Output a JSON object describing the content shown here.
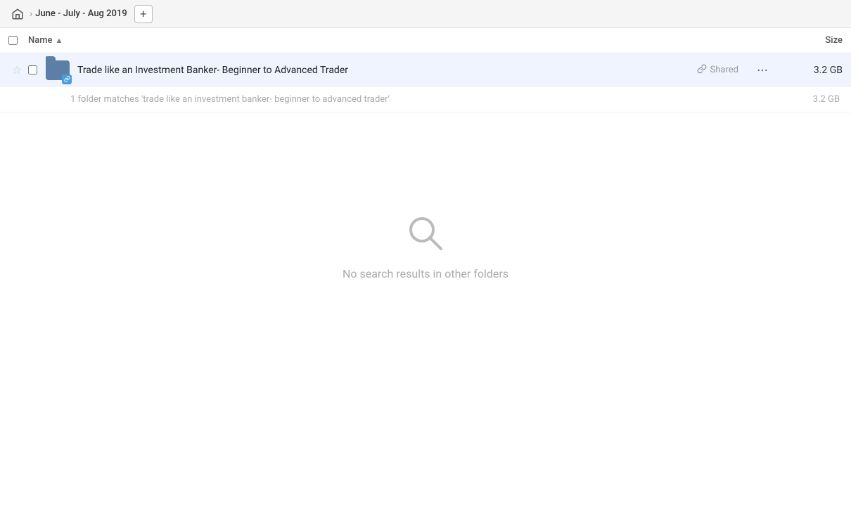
{
  "breadcrumb": {
    "home_icon": "⌂",
    "separator": "›",
    "title": "June - July - Aug 2019",
    "add_icon": "+"
  },
  "columns": {
    "name_label": "Name",
    "sort_arrow": "▲",
    "size_label": "Size"
  },
  "file_row": {
    "star_icon": "☆",
    "folder_icon_label": "folder",
    "link_badge": "🔗",
    "file_name": "Trade like an Investment Banker- Beginner to Advanced Trader",
    "shared_label": "Shared",
    "more_icon": "•••",
    "size": "3.2 GB"
  },
  "match_info": {
    "text": "1 folder matches 'trade like an investment banker- beginner to advanced trader'",
    "size": "3.2 GB"
  },
  "empty_state": {
    "message": "No search results in other folders"
  }
}
